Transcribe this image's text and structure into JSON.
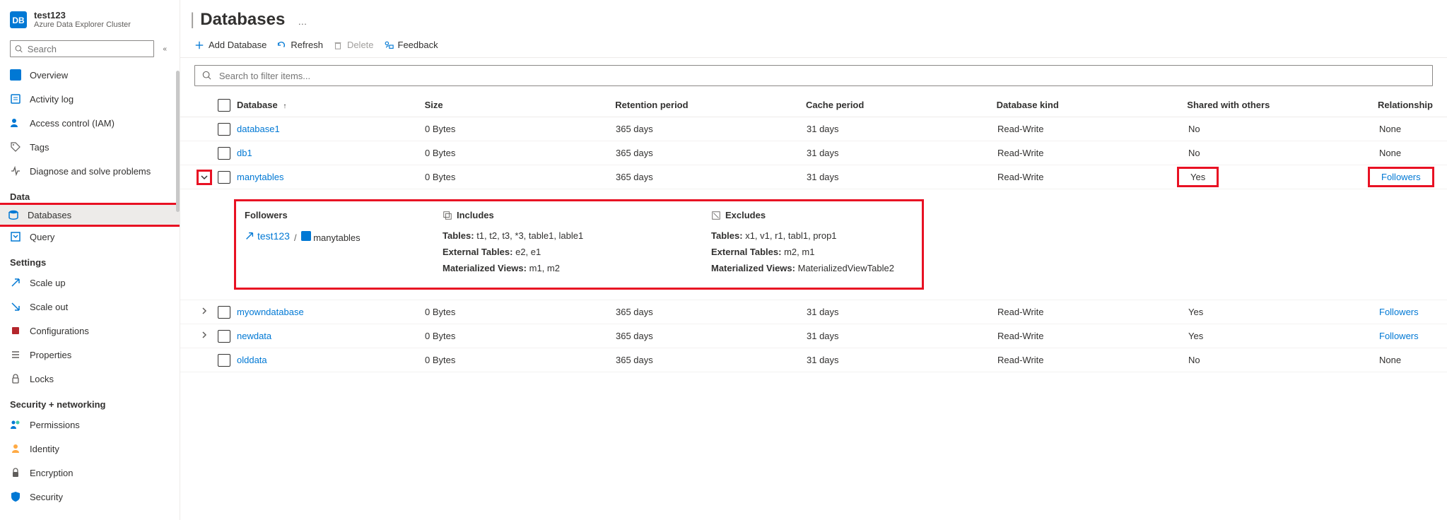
{
  "cluster": {
    "name": "test123",
    "type": "Azure Data Explorer Cluster"
  },
  "search": {
    "placeholder": "Search"
  },
  "collapse_glyph": "«",
  "sidebar": {
    "items": [
      {
        "label": "Overview",
        "icon": "overview"
      },
      {
        "label": "Activity log",
        "icon": "activity"
      },
      {
        "label": "Access control (IAM)",
        "icon": "iam"
      },
      {
        "label": "Tags",
        "icon": "tags"
      },
      {
        "label": "Diagnose and solve problems",
        "icon": "diagnose"
      }
    ],
    "data_header": "Data",
    "data_items": [
      {
        "label": "Databases",
        "icon": "database",
        "selected": true
      },
      {
        "label": "Query",
        "icon": "query"
      }
    ],
    "settings_header": "Settings",
    "settings_items": [
      {
        "label": "Scale up",
        "icon": "scaleup"
      },
      {
        "label": "Scale out",
        "icon": "scaleout"
      },
      {
        "label": "Configurations",
        "icon": "config"
      },
      {
        "label": "Properties",
        "icon": "properties"
      },
      {
        "label": "Locks",
        "icon": "locks"
      }
    ],
    "secnet_header": "Security + networking",
    "secnet_items": [
      {
        "label": "Permissions",
        "icon": "permissions"
      },
      {
        "label": "Identity",
        "icon": "identity"
      },
      {
        "label": "Encryption",
        "icon": "encryption"
      },
      {
        "label": "Security",
        "icon": "security"
      }
    ]
  },
  "page": {
    "title": "Databases",
    "more": "…"
  },
  "toolbar": {
    "add": "Add Database",
    "refresh": "Refresh",
    "delete": "Delete",
    "feedback": "Feedback"
  },
  "filter": {
    "placeholder": "Search to filter items..."
  },
  "columns": {
    "name": "Database",
    "sort": "↑",
    "size": "Size",
    "retention": "Retention period",
    "cache": "Cache period",
    "kind": "Database kind",
    "shared": "Shared with others",
    "relationship": "Relationship"
  },
  "rows": [
    {
      "name": "database1",
      "size": "0 Bytes",
      "retention": "365 days",
      "cache": "31 days",
      "kind": "Read-Write",
      "shared": "No",
      "rel": "None",
      "rel_link": false,
      "shared_h": false,
      "rel_h": false
    },
    {
      "name": "db1",
      "size": "0 Bytes",
      "retention": "365 days",
      "cache": "31 days",
      "kind": "Read-Write",
      "shared": "No",
      "rel": "None",
      "rel_link": false,
      "shared_h": false,
      "rel_h": false
    },
    {
      "name": "manytables",
      "size": "0 Bytes",
      "retention": "365 days",
      "cache": "31 days",
      "kind": "Read-Write",
      "shared": "Yes",
      "rel": "Followers",
      "rel_link": true,
      "shared_h": true,
      "rel_h": true,
      "expanded": true,
      "chev_h": true
    },
    {
      "name": "myowndatabase",
      "size": "0 Bytes",
      "retention": "365 days",
      "cache": "31 days",
      "kind": "Read-Write",
      "shared": "Yes",
      "rel": "Followers",
      "rel_link": true,
      "shared_h": false,
      "rel_h": false,
      "chev": true
    },
    {
      "name": "newdata",
      "size": "0 Bytes",
      "retention": "365 days",
      "cache": "31 days",
      "kind": "Read-Write",
      "shared": "Yes",
      "rel": "Followers",
      "rel_link": true,
      "shared_h": false,
      "rel_h": false,
      "chev": true
    },
    {
      "name": "olddata",
      "size": "0 Bytes",
      "retention": "365 days",
      "cache": "31 days",
      "kind": "Read-Write",
      "shared": "No",
      "rel": "None",
      "rel_link": false,
      "shared_h": false,
      "rel_h": false
    }
  ],
  "detail": {
    "followers_head": "Followers",
    "includes_head": "Includes",
    "excludes_head": "Excludes",
    "follower_cluster": "test123",
    "follower_db": "manytables",
    "sep": "/",
    "includes": {
      "tables_l": "Tables:",
      "tables_v": "t1, t2, t3, *3, table1, lable1",
      "ext_l": "External Tables:",
      "ext_v": "e2, e1",
      "mv_l": "Materialized Views:",
      "mv_v": "m1, m2"
    },
    "excludes": {
      "tables_l": "Tables:",
      "tables_v": "x1, v1, r1, tabl1, prop1",
      "ext_l": "External Tables:",
      "ext_v": "m2, m1",
      "mv_l": "Materialized Views:",
      "mv_v": "MaterializedViewTable2"
    }
  }
}
